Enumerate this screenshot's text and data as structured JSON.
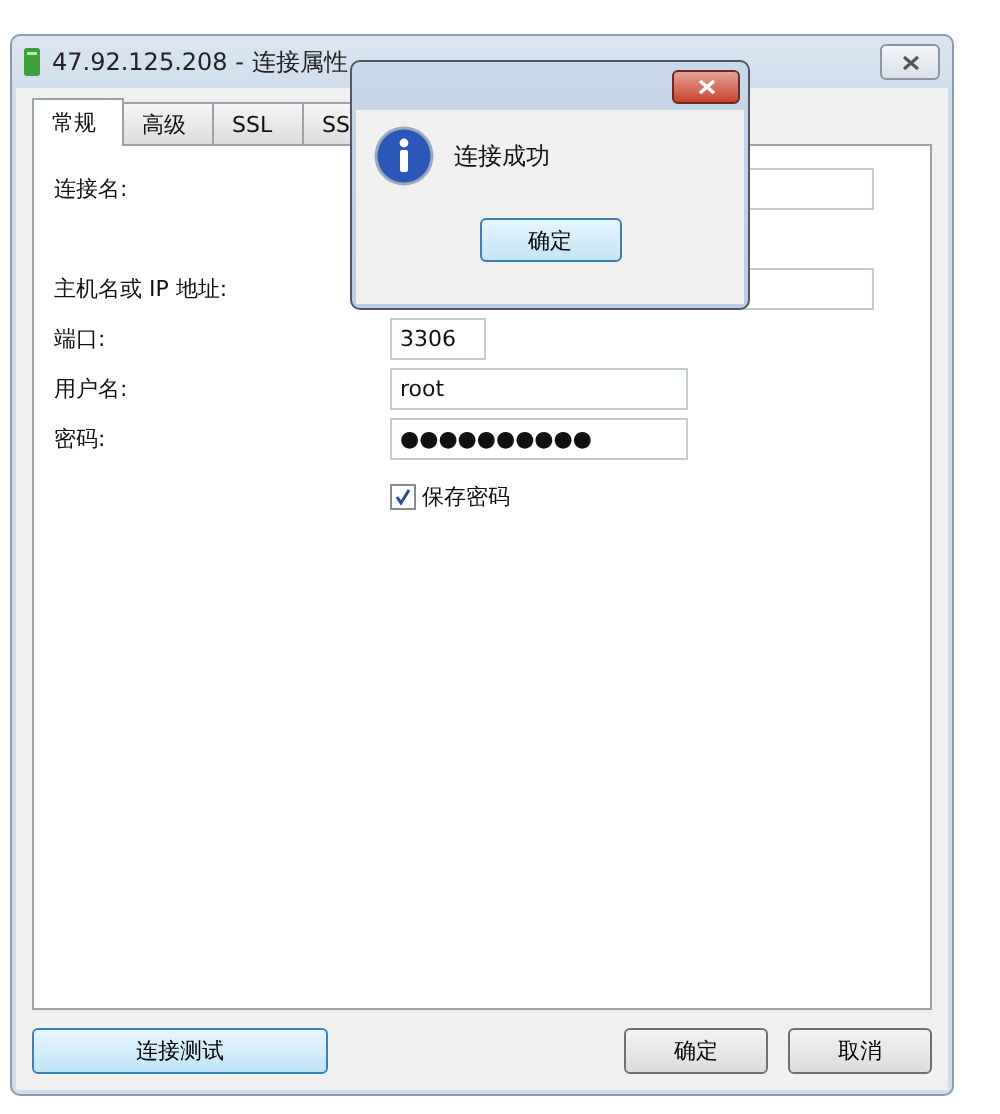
{
  "window": {
    "title": "47.92.125.208 - 连接属性"
  },
  "tabs": [
    {
      "label": "常规",
      "selected": true
    },
    {
      "label": "高级",
      "selected": false
    },
    {
      "label": "SSL",
      "selected": false
    },
    {
      "label": "SS",
      "selected": false
    }
  ],
  "form": {
    "fields": [
      {
        "label": "连接名:"
      },
      {
        "label": "主机名或 IP 地址:"
      },
      {
        "label": "端口:",
        "value": "3306"
      },
      {
        "label": "用户名:",
        "value": "root"
      },
      {
        "label": "密码:",
        "value": "●●●●●●●●●●"
      }
    ],
    "save_password": {
      "label": "保存密码",
      "checked": true
    }
  },
  "buttons": {
    "test": "连接测试",
    "ok": "确定",
    "cancel": "取消"
  },
  "dialog": {
    "message": "连接成功",
    "ok": "确定"
  }
}
